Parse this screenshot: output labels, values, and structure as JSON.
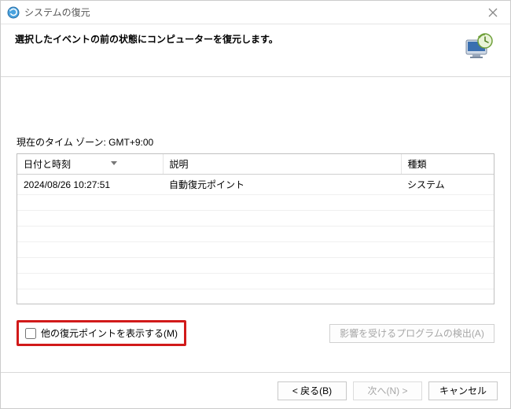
{
  "window": {
    "title": "システムの復元"
  },
  "header": {
    "heading": "選択したイベントの前の状態にコンピューターを復元します。"
  },
  "timezone": {
    "label": "現在のタイム ゾーン: GMT+9:00"
  },
  "table": {
    "columns": {
      "datetime": "日付と時刻",
      "description": "説明",
      "type": "種類"
    },
    "rows": [
      {
        "datetime": "2024/08/26 10:27:51",
        "description": "自動復元ポイント",
        "type": "システム"
      }
    ]
  },
  "options": {
    "show_more_label": "他の復元ポイントを表示する(M)",
    "scan_affected_label": "影響を受けるプログラムの検出(A)"
  },
  "buttons": {
    "back": "< 戻る(B)",
    "next": "次へ(N) >",
    "cancel": "キャンセル"
  }
}
